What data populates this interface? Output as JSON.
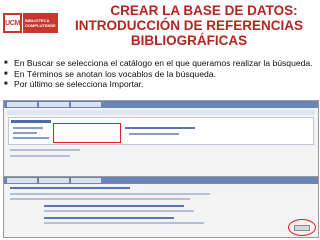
{
  "logo": {
    "mark": "UCM",
    "text_line1": "BIBLIOTECA",
    "text_line2": "COMPLUTENSE"
  },
  "title": {
    "line1": "CREAR LA BASE DE DATOS:",
    "line2": "INTRODUCCIÓN DE REFERENCIAS",
    "line3": "BIBLIOGRÁFICAS"
  },
  "bullets": [
    "En Buscar se selecciona el catálogo en el que queramos realizar la búsqueda.",
    "En Términos se anotan los vocablos de la búsqueda.",
    "Por último se selecciona Importar."
  ]
}
